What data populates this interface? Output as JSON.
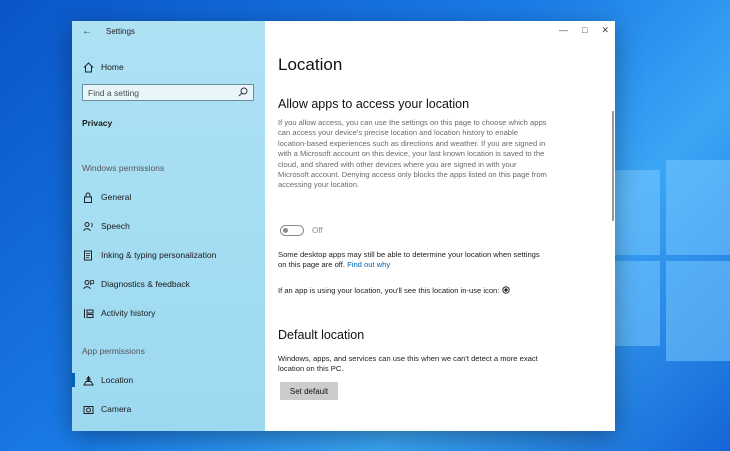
{
  "window": {
    "title": "Settings"
  },
  "sidebar": {
    "home_label": "Home",
    "search_placeholder": "Find a setting",
    "category": "Privacy",
    "windows_permissions_label": "Windows permissions",
    "windows_items": [
      {
        "label": "General",
        "icon": "lock-icon"
      },
      {
        "label": "Speech",
        "icon": "speech-icon"
      },
      {
        "label": "Inking & typing personalization",
        "icon": "inking-icon"
      },
      {
        "label": "Diagnostics & feedback",
        "icon": "feedback-icon"
      },
      {
        "label": "Activity history",
        "icon": "activity-icon"
      }
    ],
    "app_permissions_label": "App permissions",
    "app_items": [
      {
        "label": "Location",
        "icon": "location-icon",
        "active": true
      },
      {
        "label": "Camera",
        "icon": "camera-icon",
        "active": false
      }
    ]
  },
  "content": {
    "page_title": "Location",
    "allow_heading": "Allow apps to access your location",
    "allow_description": "If you allow access, you can use the settings on this page to choose which apps can access your device's precise location and location history to enable location-based experiences such as directions and weather. If you are signed in with a Microsoft account on this device, your last known location is saved to the cloud, and shared with other devices where you are signed in with your Microsoft account. Denying access only blocks the apps listed on this page from accessing your location.",
    "toggle_state": "Off",
    "desktop_note": "Some desktop apps may still be able to determine your location when settings on this page are off.",
    "find_out_link": "Find out why",
    "in_use_note": "If an app is using your location, you'll see this location in-use icon:",
    "default_heading": "Default location",
    "default_description": "Windows, apps, and services can use this when we can't detect a more exact location on this PC.",
    "set_default_button": "Set default"
  },
  "colors": {
    "accent": "#0063b1",
    "sidebar_bg": "#aee1f4"
  }
}
